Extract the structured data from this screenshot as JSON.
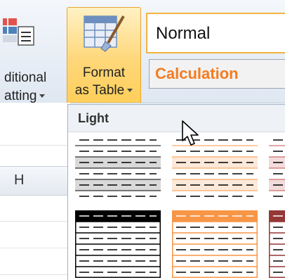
{
  "ribbon": {
    "conditional_formatting": {
      "line1": "ditional",
      "line2": "atting",
      "icon": "conditional-formatting-icon"
    },
    "format_as_table": {
      "line1": "Format",
      "line2": "as Table",
      "icon": "format-as-table-icon"
    },
    "cell_styles": [
      {
        "label": "Normal"
      },
      {
        "label": "Calculation"
      }
    ]
  },
  "sheet": {
    "column_header": "H"
  },
  "gallery": {
    "section_label": "Light",
    "swatches": [
      {
        "style": "none-lines",
        "color": "#000000",
        "band": "#d9d9d9"
      },
      {
        "style": "light-orange",
        "color": "#f79646",
        "band": "#fde9d9"
      },
      {
        "style": "light-red",
        "color": "#c0504d",
        "band": "#f2dcdb"
      },
      {
        "style": "dark-header-black",
        "color": "#000000",
        "band": "#ffffff"
      },
      {
        "style": "header-orange",
        "color": "#f79646",
        "band": "#ffffff"
      },
      {
        "style": "header-red",
        "color": "#953735",
        "band": "#ffffff"
      }
    ]
  },
  "colors": {
    "accent": "#f47c20",
    "highlight": "#ffd77a",
    "border": "#e8a531"
  }
}
